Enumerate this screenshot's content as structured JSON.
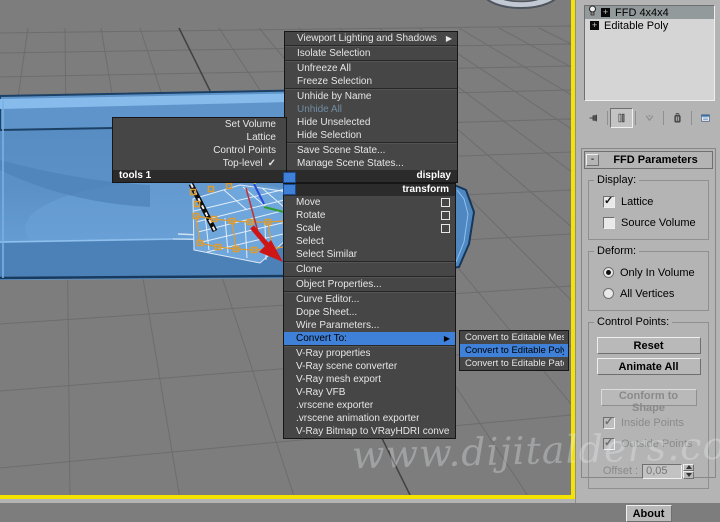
{
  "watermark_text": "www.dijitalders.com",
  "menus": {
    "tools1": {
      "title": "tools 1",
      "items": [
        {
          "label": "Set Volume"
        },
        {
          "label": "Lattice"
        },
        {
          "label": "Control Points"
        },
        {
          "label": "Top-level",
          "checked": true
        }
      ]
    },
    "display": {
      "title": "display",
      "items": [
        {
          "label": "Viewport Lighting and Shadows",
          "submenu": true
        },
        {
          "sep": true
        },
        {
          "label": "Isolate Selection"
        },
        {
          "sep": true
        },
        {
          "label": "Unfreeze All"
        },
        {
          "label": "Freeze Selection"
        },
        {
          "sep": true
        },
        {
          "label": "Unhide by Name"
        },
        {
          "label": "Unhide All",
          "disabled": true
        },
        {
          "label": "Hide Unselected"
        },
        {
          "label": "Hide Selection"
        },
        {
          "sep": true
        },
        {
          "label": "Save Scene State..."
        },
        {
          "label": "Manage Scene States..."
        }
      ]
    },
    "transform": {
      "title": "transform",
      "items": [
        {
          "label": "Move",
          "settings": true
        },
        {
          "label": "Rotate",
          "settings": true
        },
        {
          "label": "Scale",
          "settings": true
        },
        {
          "label": "Select"
        },
        {
          "label": "Select Similar"
        },
        {
          "sep": true
        },
        {
          "label": "Clone"
        },
        {
          "sep": true
        },
        {
          "label": "Object Properties..."
        },
        {
          "sep": true
        },
        {
          "label": "Curve Editor..."
        },
        {
          "label": "Dope Sheet..."
        },
        {
          "label": "Wire Parameters..."
        },
        {
          "label": "Convert To:",
          "submenu": true,
          "highlight": true
        },
        {
          "sep": true
        },
        {
          "label": "V-Ray properties"
        },
        {
          "label": "V-Ray scene converter"
        },
        {
          "label": "V-Ray mesh export"
        },
        {
          "label": "V-Ray VFB"
        },
        {
          "label": ".vrscene exporter"
        },
        {
          "label": ".vrscene animation exporter"
        },
        {
          "label": "V-Ray Bitmap to VRayHDRI converter"
        }
      ]
    },
    "convert_to": {
      "items": [
        {
          "label": "Convert to Editable Mesh"
        },
        {
          "label": "Convert to Editable Poly",
          "highlight": true
        },
        {
          "label": "Convert to Editable Patch"
        }
      ]
    }
  },
  "panel": {
    "modifier_stack": {
      "rows": [
        {
          "label": "FFD 4x4x4",
          "selected": true,
          "icons": [
            "lightbulb",
            "plus-box"
          ]
        },
        {
          "label": "Editable Poly",
          "selected": false,
          "icons": [
            "plus-box"
          ]
        }
      ]
    },
    "stack_toolbar": [
      {
        "name": "pin-stack",
        "pressed": false,
        "disabled": false
      },
      {
        "name": "show-end-result",
        "pressed": true,
        "disabled": false
      },
      {
        "name": "make-unique",
        "pressed": false,
        "disabled": true
      },
      {
        "name": "remove-modifier",
        "pressed": false,
        "disabled": false
      },
      {
        "name": "configure-modifier-sets",
        "pressed": false,
        "disabled": false
      }
    ],
    "rollout": {
      "collapse_label": "-",
      "title": "FFD Parameters",
      "display_group": {
        "label": "Display:",
        "items": [
          {
            "type": "checkbox",
            "label": "Lattice",
            "checked": true
          },
          {
            "type": "checkbox",
            "label": "Source Volume",
            "checked": false
          }
        ]
      },
      "deform_group": {
        "label": "Deform:",
        "items": [
          {
            "type": "radio",
            "label": "Only In Volume",
            "checked": true
          },
          {
            "type": "radio",
            "label": "All Vertices",
            "checked": false
          }
        ]
      },
      "control_points_group": {
        "label": "Control Points:",
        "buttons": [
          {
            "label": "Reset",
            "disabled": false
          },
          {
            "label": "Animate All",
            "disabled": false
          },
          {
            "label": "Conform to Shape",
            "disabled": true
          }
        ],
        "checks": [
          {
            "label": "Inside Points",
            "checked": true,
            "disabled": true
          },
          {
            "label": "Outside Points",
            "checked": true,
            "disabled": true
          }
        ],
        "offset_label": "Offset :",
        "offset_value": "0,05"
      },
      "about_label": "About"
    }
  },
  "colors": {
    "highlight_blue": "#3f80d8",
    "viewport_border_yellow": "#f4e300",
    "menu_bg": "#464646",
    "panel_bg": "#b4b4b4",
    "sofa_blue": "#5b91c6",
    "lattice_orange": "#e09b2d"
  }
}
